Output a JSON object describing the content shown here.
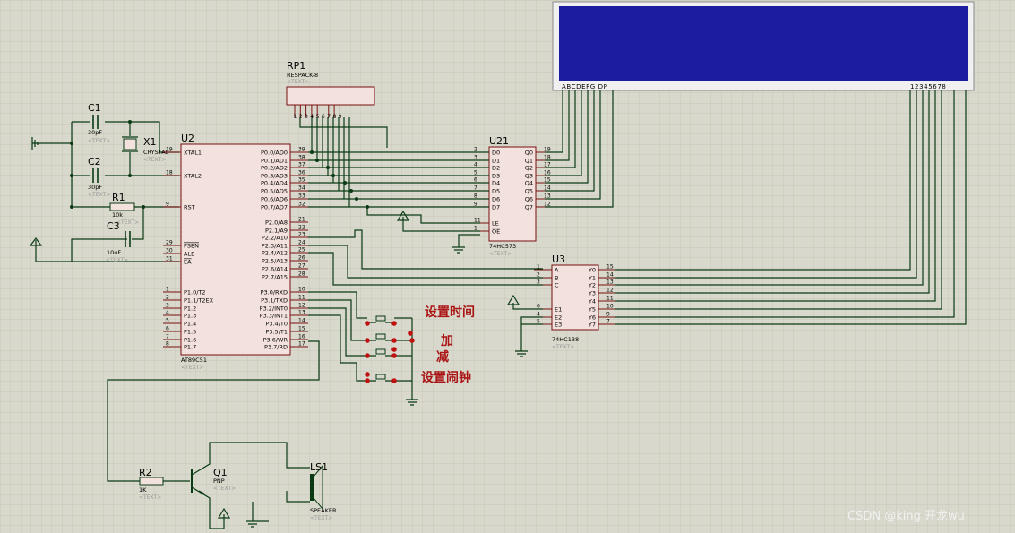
{
  "components": {
    "C1": {
      "ref": "C1",
      "value": "30pF",
      "text": "<TEXT>"
    },
    "C2": {
      "ref": "C2",
      "value": "30pF",
      "text": "<TEXT>"
    },
    "C3": {
      "ref": "C3",
      "value": "10uF",
      "text": "<TEXT>"
    },
    "X1": {
      "ref": "X1",
      "value": "CRYSTAL",
      "text": "<TEXT>"
    },
    "R1": {
      "ref": "R1",
      "value": "10k",
      "text": "<TEXT>"
    },
    "R2": {
      "ref": "R2",
      "value": "1K",
      "text": "<TEXT>"
    },
    "Q1": {
      "ref": "Q1",
      "value": "PNP",
      "text": "<TEXT>"
    },
    "LS1": {
      "ref": "LS1",
      "value": "SPEAKER",
      "text": "<TEXT>"
    },
    "RP1": {
      "ref": "RP1",
      "value": "RESPACK-8",
      "text": "<TEXT>"
    },
    "U2": {
      "ref": "U2",
      "value": "AT89C51",
      "text": "<TEXT>"
    },
    "U21": {
      "ref": "U21",
      "value": "74HC573",
      "text": "<TEXT>"
    },
    "U3": {
      "ref": "U3",
      "value": "74HC138",
      "text": "<TEXT>"
    }
  },
  "u2_left_pins": [
    {
      "name": "XTAL1",
      "num": "19"
    },
    {
      "name": "XTAL2",
      "num": "18"
    },
    {
      "name": "RST",
      "num": "9"
    },
    {
      "name": "PSEN",
      "num": "29"
    },
    {
      "name": "ALE",
      "num": "30"
    },
    {
      "name": "EA",
      "num": "31"
    },
    {
      "name": "P1.0/T2",
      "num": "1"
    },
    {
      "name": "P1.1/T2EX",
      "num": "2"
    },
    {
      "name": "P1.2",
      "num": "3"
    },
    {
      "name": "P1.3",
      "num": "4"
    },
    {
      "name": "P1.4",
      "num": "5"
    },
    {
      "name": "P1.5",
      "num": "6"
    },
    {
      "name": "P1.6",
      "num": "7"
    },
    {
      "name": "P1.7",
      "num": "8"
    }
  ],
  "u2_right_pins": [
    {
      "name": "P0.0/AD0",
      "num": "39"
    },
    {
      "name": "P0.1/AD1",
      "num": "38"
    },
    {
      "name": "P0.2/AD2",
      "num": "37"
    },
    {
      "name": "P0.3/AD3",
      "num": "36"
    },
    {
      "name": "P0.4/AD4",
      "num": "35"
    },
    {
      "name": "P0.5/AD5",
      "num": "34"
    },
    {
      "name": "P0.6/AD6",
      "num": "33"
    },
    {
      "name": "P0.7/AD7",
      "num": "32"
    },
    {
      "name": "P2.0/A8",
      "num": "21"
    },
    {
      "name": "P2.1/A9",
      "num": "22"
    },
    {
      "name": "P2.2/A10",
      "num": "23"
    },
    {
      "name": "P2.3/A11",
      "num": "24"
    },
    {
      "name": "P2.4/A12",
      "num": "25"
    },
    {
      "name": "P2.5/A13",
      "num": "26"
    },
    {
      "name": "P2.6/A14",
      "num": "27"
    },
    {
      "name": "P2.7/A15",
      "num": "28"
    },
    {
      "name": "P3.0/RXD",
      "num": "10"
    },
    {
      "name": "P3.1/TXD",
      "num": "11"
    },
    {
      "name": "P3.2/INT0",
      "num": "12"
    },
    {
      "name": "P3.3/INT1",
      "num": "13"
    },
    {
      "name": "P3.4/T0",
      "num": "14"
    },
    {
      "name": "P3.5/T1",
      "num": "15"
    },
    {
      "name": "P3.6/WR",
      "num": "16"
    },
    {
      "name": "P3.7/RD",
      "num": "17"
    }
  ],
  "u21_left_pins": [
    {
      "name": "D0",
      "num": "2"
    },
    {
      "name": "D1",
      "num": "3"
    },
    {
      "name": "D2",
      "num": "4"
    },
    {
      "name": "D3",
      "num": "5"
    },
    {
      "name": "D4",
      "num": "6"
    },
    {
      "name": "D5",
      "num": "7"
    },
    {
      "name": "D6",
      "num": "8"
    },
    {
      "name": "D7",
      "num": "9"
    },
    {
      "name": "LE",
      "num": "11"
    },
    {
      "name": "OE",
      "num": "1"
    }
  ],
  "u21_right_pins": [
    {
      "name": "Q0",
      "num": "19"
    },
    {
      "name": "Q1",
      "num": "18"
    },
    {
      "name": "Q2",
      "num": "17"
    },
    {
      "name": "Q3",
      "num": "16"
    },
    {
      "name": "Q4",
      "num": "15"
    },
    {
      "name": "Q5",
      "num": "14"
    },
    {
      "name": "Q6",
      "num": "13"
    },
    {
      "name": "Q7",
      "num": "12"
    }
  ],
  "u3_left_pins": [
    {
      "name": "A",
      "num": "1"
    },
    {
      "name": "B",
      "num": "2"
    },
    {
      "name": "C",
      "num": "3"
    },
    {
      "name": "E1",
      "num": "6"
    },
    {
      "name": "E2",
      "num": "4"
    },
    {
      "name": "E3",
      "num": "5"
    }
  ],
  "u3_right_pins": [
    {
      "name": "Y0",
      "num": "15"
    },
    {
      "name": "Y1",
      "num": "14"
    },
    {
      "name": "Y2",
      "num": "13"
    },
    {
      "name": "Y3",
      "num": "12"
    },
    {
      "name": "Y4",
      "num": "11"
    },
    {
      "name": "Y5",
      "num": "10"
    },
    {
      "name": "Y6",
      "num": "9"
    },
    {
      "name": "Y7",
      "num": "7"
    }
  ],
  "rp1_pins": [
    "1",
    "2",
    "3",
    "4",
    "5",
    "6",
    "7",
    "8",
    "9"
  ],
  "display": {
    "segments_label": "ABCDEFG DP",
    "digits_label": "12345678"
  },
  "button_labels": {
    "set_time": "设置时间",
    "add": "加",
    "sub": "减",
    "set_alarm": "设置闹钟"
  },
  "watermark": "CSDN @king 开龙wu",
  "colors": {
    "background": "#d8d8cc",
    "grid": "#c2c2b2",
    "wire": "#0a3a14",
    "chip_fill": "#f3e1dd",
    "chip_border": "#7a1010",
    "display_fill": "#1c1ca0",
    "label_red": "#aa1414"
  }
}
